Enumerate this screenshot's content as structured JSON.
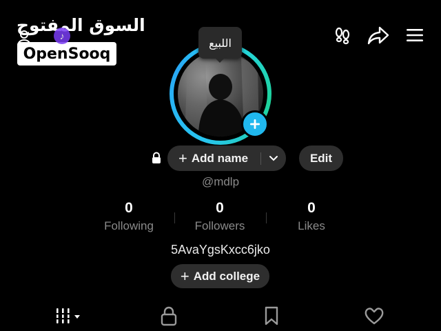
{
  "watermark": {
    "arabic": "السوق المفتوح",
    "brand": "OpenSooq"
  },
  "header": {
    "icons": [
      "add-friend-icon",
      "tiktok-icon",
      "footprints-icon",
      "share-icon",
      "menu-icon"
    ]
  },
  "avatar": {
    "tooltip": "اللبيع",
    "ring_colors": [
      "#27d4f3",
      "#1ed39b"
    ],
    "plus_color": "#20b8ee"
  },
  "profile": {
    "add_name_label": "Add name",
    "edit_label": "Edit",
    "username": "@mdlp",
    "bio": "5AvaYgsKxcc6jko",
    "add_college_label": "Add college"
  },
  "stats": [
    {
      "value": "0",
      "label": "Following"
    },
    {
      "value": "0",
      "label": "Followers"
    },
    {
      "value": "0",
      "label": "Likes"
    }
  ],
  "tabs": [
    "videos-grid-icon",
    "private-lock-icon",
    "favorites-bookmark-icon",
    "liked-heart-icon"
  ]
}
